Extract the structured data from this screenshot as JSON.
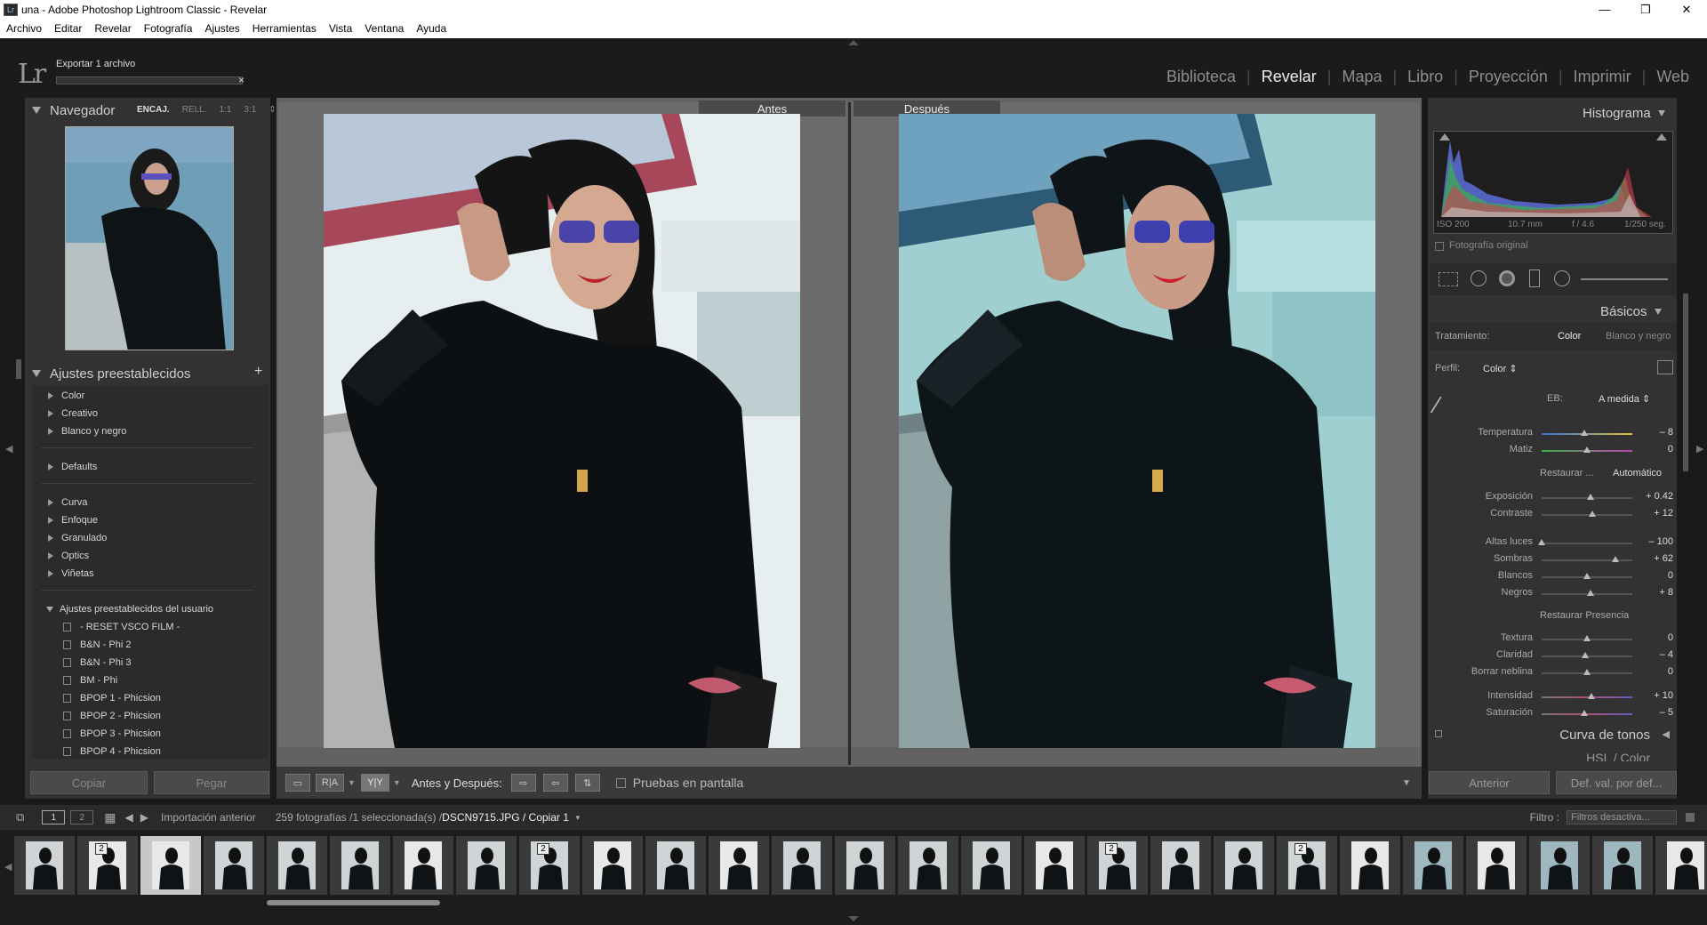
{
  "window": {
    "title": "una - Adobe Photoshop Lightroom Classic - Revelar",
    "app_icon": "Lr",
    "controls": [
      "—",
      "❐",
      "✕"
    ]
  },
  "menu": [
    "Archivo",
    "Editar",
    "Revelar",
    "Fotografía",
    "Ajustes",
    "Herramientas",
    "Vista",
    "Ventana",
    "Ayuda"
  ],
  "identity": {
    "logo": "Lr",
    "task_label": "Exportar 1 archivo",
    "task_close": "×"
  },
  "modules": [
    {
      "label": "Biblioteca",
      "active": false
    },
    {
      "label": "Revelar",
      "active": true
    },
    {
      "label": "Mapa",
      "active": false
    },
    {
      "label": "Libro",
      "active": false
    },
    {
      "label": "Proyección",
      "active": false
    },
    {
      "label": "Imprimir",
      "active": false
    },
    {
      "label": "Web",
      "active": false
    }
  ],
  "navigator": {
    "title": "Navegador",
    "options": [
      "ENCAJ.",
      "RELL.",
      "1:1",
      "3:1"
    ],
    "active_option": "ENCAJ."
  },
  "presets": {
    "title": "Ajustes preestablecidos",
    "add_icon": "+",
    "groups": [
      "Color",
      "Creativo",
      "Blanco y negro",
      "Defaults",
      "Curva",
      "Enfoque",
      "Granulado",
      "Optics",
      "Viñetas",
      "Ajustes preestablecidos del usuario"
    ],
    "user_items": [
      "- RESET VSCO FILM -",
      "B&N - Phi 2",
      "B&N - Phi 3",
      "BM - Phi",
      "BPOP 1 - Phicsion",
      "BPOP 2 - Phicsion",
      "BPOP 3 - Phicsion",
      "BPOP 4 - Phicsion"
    ]
  },
  "left_buttons": {
    "copy": "Copiar",
    "paste": "Pegar"
  },
  "compare": {
    "before": "Antes",
    "after": "Después"
  },
  "toolbar": {
    "view_ra": "R|A",
    "view_yy": "Y|Y",
    "before_after_label": "Antes y Después:",
    "softproof_label": "Pruebas en pantalla"
  },
  "histogram": {
    "title": "Histograma",
    "iso": "ISO 200",
    "focal": "10.7 mm",
    "aperture": "f / 4.6",
    "shutter": "1/250 seg.",
    "original_label": "Fotografía original"
  },
  "basics": {
    "title": "Básicos",
    "treatment_label": "Tratamiento:",
    "treatment_color": "Color",
    "treatment_bw": "Blanco y negro",
    "profile_label": "Perfil:",
    "profile_value": "Color",
    "wb_label": "EB:",
    "wb_value": "A medida",
    "restore_label": "Restaurar ...",
    "auto_label": "Automático",
    "presence_label": "Restaurar Presencia",
    "sliders": [
      {
        "label": "Temperatura",
        "value": "– 8",
        "pos": 0.47
      },
      {
        "label": "Matiz",
        "value": "0",
        "pos": 0.5
      },
      {
        "label": "Exposición",
        "value": "+ 0.42",
        "pos": 0.54
      },
      {
        "label": "Contraste",
        "value": "+ 12",
        "pos": 0.56
      },
      {
        "label": "Altas luces",
        "value": "– 100",
        "pos": 0.0
      },
      {
        "label": "Sombras",
        "value": "+ 62",
        "pos": 0.81
      },
      {
        "label": "Blancos",
        "value": "0",
        "pos": 0.5
      },
      {
        "label": "Negros",
        "value": "+ 8",
        "pos": 0.54
      },
      {
        "label": "Textura",
        "value": "0",
        "pos": 0.5
      },
      {
        "label": "Claridad",
        "value": "– 4",
        "pos": 0.48
      },
      {
        "label": "Borrar neblina",
        "value": "0",
        "pos": 0.5
      },
      {
        "label": "Intensidad",
        "value": "+ 10",
        "pos": 0.55
      },
      {
        "label": "Saturación",
        "value": "– 5",
        "pos": 0.47
      }
    ]
  },
  "right_sections": {
    "tone_curve": "Curva de tonos",
    "hsl": "HSL / Color"
  },
  "right_buttons": {
    "previous": "Anterior",
    "reset": "Def. val. por def..."
  },
  "filmstrip_bar": {
    "page1": "1",
    "page2": "2",
    "source": "Importación anterior",
    "count": "259 fotografías /1 seleccionada(s) /",
    "filename": "DSCN9715.JPG / Copiar 1",
    "filter_label": "Filtro :",
    "filter_value": "Filtros desactiva..."
  },
  "filmstrip": {
    "cells": [
      {
        "badge": ""
      },
      {
        "badge": "2"
      },
      {
        "badge": "",
        "selected": true
      },
      {
        "badge": ""
      },
      {
        "badge": ""
      },
      {
        "badge": ""
      },
      {
        "badge": ""
      },
      {
        "badge": ""
      },
      {
        "badge": "2"
      },
      {
        "badge": ""
      },
      {
        "badge": ""
      },
      {
        "badge": ""
      },
      {
        "badge": ""
      },
      {
        "badge": ""
      },
      {
        "badge": ""
      },
      {
        "badge": ""
      },
      {
        "badge": ""
      },
      {
        "badge": "2"
      },
      {
        "badge": ""
      },
      {
        "badge": ""
      },
      {
        "badge": "2"
      },
      {
        "badge": ""
      },
      {
        "badge": ""
      },
      {
        "badge": ""
      },
      {
        "badge": ""
      },
      {
        "badge": ""
      },
      {
        "badge": ""
      }
    ]
  }
}
